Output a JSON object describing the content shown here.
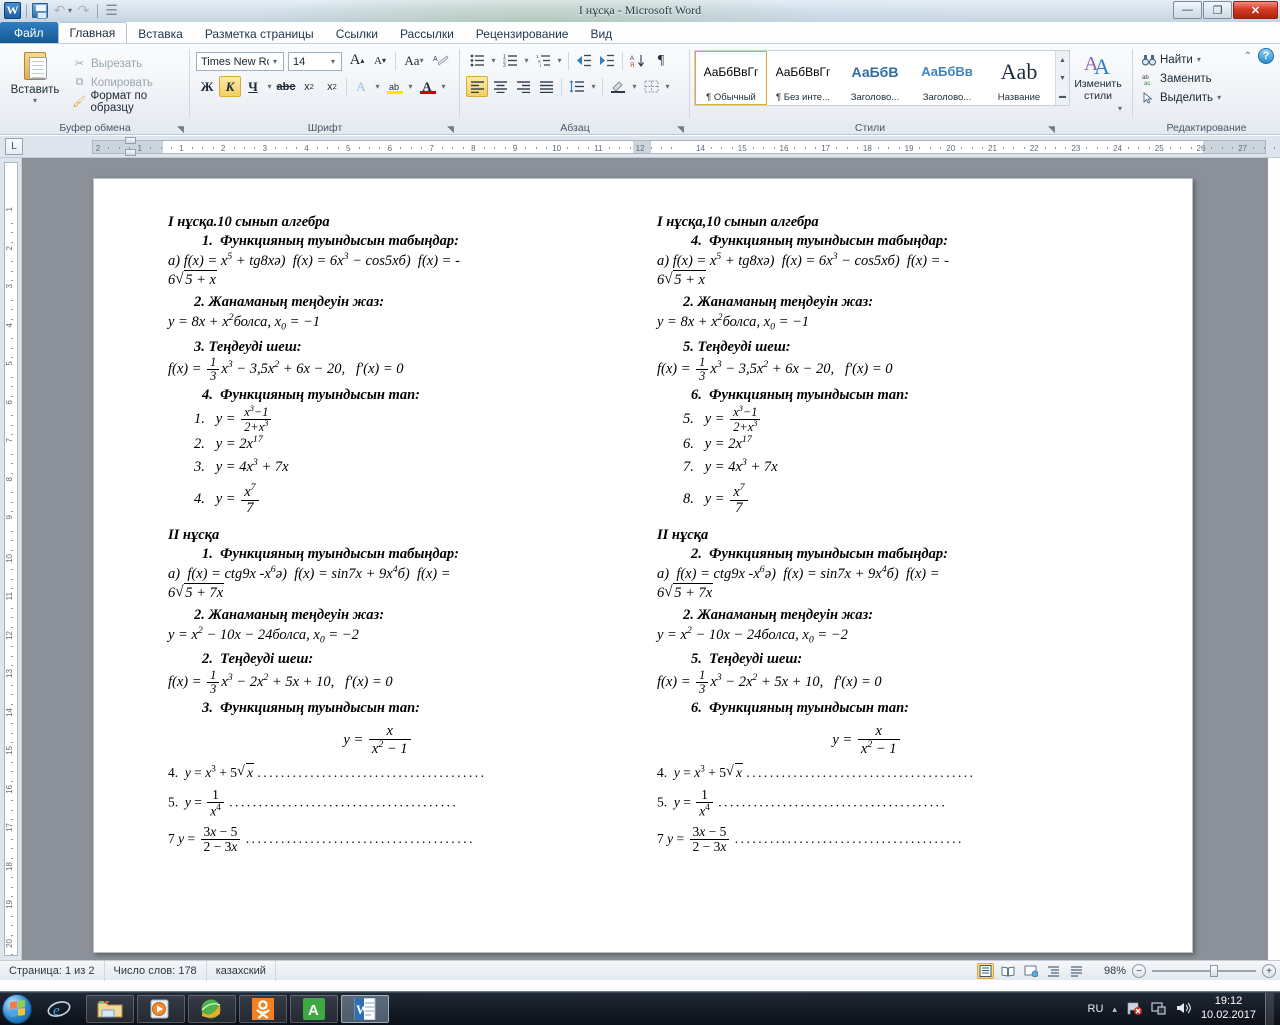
{
  "window": {
    "title": "I нұсқа  -  Microsoft Word",
    "minimize": "—",
    "maximize": "❐",
    "close": "✕",
    "help": "?",
    "collapse_ribbon": "⌃",
    "qat": {
      "word_icon": "W",
      "save": "save-icon",
      "undo": "↶",
      "redo": "↷",
      "customize": "▾"
    }
  },
  "tabs": [
    {
      "label": "Файл",
      "id": "file"
    },
    {
      "label": "Главная",
      "id": "home"
    },
    {
      "label": "Вставка",
      "id": "insert"
    },
    {
      "label": "Разметка страницы",
      "id": "layout"
    },
    {
      "label": "Ссылки",
      "id": "references"
    },
    {
      "label": "Рассылки",
      "id": "mailings"
    },
    {
      "label": "Рецензирование",
      "id": "review"
    },
    {
      "label": "Вид",
      "id": "view"
    }
  ],
  "ribbon": {
    "clipboard": {
      "group_label": "Буфер обмена",
      "paste": "Вставить",
      "paste_arrow": "▾",
      "cut": "Вырезать",
      "copy": "Копировать",
      "format_painter": "Формат по образцу"
    },
    "font": {
      "group_label": "Шрифт",
      "font_name": "Times New Rc",
      "font_size": "14",
      "grow": "A",
      "shrink": "A",
      "change_case": "Aa",
      "clear_format": "A",
      "bold": "Ж",
      "italic": "К",
      "underline": "Ч",
      "strike": "abc",
      "subscript": "x₂",
      "superscript": "x²",
      "text_effects": "A",
      "highlight": "ab",
      "font_color": "A",
      "arrow": "▾"
    },
    "paragraph": {
      "group_label": "Абзац",
      "bullets": "•≡",
      "numbering": "1≡",
      "multilevel": "¹≡",
      "decrease_indent": "⇤",
      "increase_indent": "⇥",
      "sort": "А Я",
      "show_marks": "¶",
      "align_left": "≡",
      "align_center": "≡",
      "align_right": "≡",
      "justify": "≡",
      "line_spacing": "↕≡",
      "shading": "▩",
      "borders": "▦"
    },
    "styles": {
      "group_label": "Стили",
      "change_styles": "Изменить\nстили",
      "change_styles_line1": "Изменить",
      "change_styles_line2": "стили",
      "items": [
        {
          "preview": "АаБбВвГг",
          "name": "¶ Обычный",
          "selected": true
        },
        {
          "preview": "АаБбВвГг",
          "name": "¶ Без инте...",
          "selected": false
        },
        {
          "preview": "АаБбВ",
          "name": "Заголово...",
          "selected": false
        },
        {
          "preview": "АаБбВв",
          "name": "Заголово...",
          "selected": false
        },
        {
          "preview": "Aab",
          "name": "Название",
          "selected": false
        }
      ]
    },
    "editing": {
      "group_label": "Редактирование",
      "find": "Найти",
      "replace": "Заменить",
      "select": "Выделить",
      "arrow": "▾"
    }
  },
  "ruler": {
    "horizontal_left": [
      "2",
      "1",
      "1",
      "2",
      "3",
      "4",
      "5",
      "6",
      "7",
      "8",
      "9",
      "10",
      "11",
      "12"
    ],
    "horizontal_right": [
      "14",
      "15",
      "16",
      "17",
      "18",
      "19",
      "20",
      "21",
      "22",
      "23",
      "24",
      "25",
      "26",
      "27"
    ],
    "vertical": [
      "1",
      "2",
      "3",
      "4",
      "5",
      "6",
      "7",
      "8",
      "9",
      "10",
      "11",
      "12",
      "13",
      "14",
      "15",
      "16",
      "17",
      "18",
      "19",
      "20"
    ]
  },
  "document": {
    "columns": [
      {
        "id": "left-column",
        "lines": [
          {
            "t": "heading",
            "text": "I нұсқа.10 сынып алгебра"
          },
          {
            "t": "task",
            "num": "1.",
            "text": "Функцияның туындысын табыңдар:"
          },
          {
            "t": "formula",
            "text": "а) f(x) = x⁵ + tg8xә)  f(x) = 6x³ − cos5xб)  f(x) = - 6√5 + x"
          },
          {
            "t": "task2",
            "num": "2.",
            "text": "Жанаманың теңдеуін жаз:"
          },
          {
            "t": "formula",
            "text": "y = 8x + x²болса, x₀ =  −1"
          },
          {
            "t": "task2",
            "num": "3.",
            "text": "Теңдеуді шеш:"
          },
          {
            "t": "formula",
            "text": "f(x) = ⅓x³ − 3,5x² + 6x − 20,   f′(x) = 0"
          },
          {
            "t": "task",
            "num": "4.",
            "text": "Функцияның туындысын тап:"
          },
          {
            "t": "item",
            "num": "1.",
            "text": "y = (x³−1)/(2+x³)"
          },
          {
            "t": "item",
            "num": "2.",
            "text": "y = 2x¹⁷"
          },
          {
            "t": "item",
            "num": "3.",
            "text": "y = 4x³ + 7x"
          },
          {
            "t": "item",
            "num": "4.",
            "text": "y = x⁷/7"
          },
          {
            "t": "heading",
            "text": "II нұсқа"
          },
          {
            "t": "task",
            "num": "1.",
            "text": "Функцияның туындысын табыңдар:"
          },
          {
            "t": "formula",
            "text": "а)  f(x) = ctg9x -x⁶ә)  f(x) = sin7x + 9x⁴б)  f(x) = 6√5 + 7x"
          },
          {
            "t": "task2",
            "num": "2.",
            "text": "Жанаманың теңдеуін жаз:"
          },
          {
            "t": "formula",
            "text": "y = x² − 10x − 24болса, x₀ =  −2"
          },
          {
            "t": "task2",
            "num": "2.",
            "text": "Теңдеуді шеш:"
          },
          {
            "t": "formula",
            "text": "f(x) = ⅓x³ − 2x² + 5x + 10,   f′(x) = 0"
          },
          {
            "t": "task",
            "num": "3.",
            "text": "Функцияның туындысын тап:"
          },
          {
            "t": "centered",
            "text": "y = x/(x² − 1)"
          },
          {
            "t": "dotted",
            "num": "4.",
            "text": "y = x³ + 5√x"
          },
          {
            "t": "dotted",
            "num": "5.",
            "text": "y = 1/x⁴"
          },
          {
            "t": "dotted",
            "num": "7",
            "text": "y = (3x−5)/(2−3x)"
          }
        ],
        "headings": {
          "h1": "I нұсқа.10 сынып алгебра",
          "h2": "II нұсқа"
        },
        "numbers": {
          "t1": "1.",
          "t2": "2.",
          "t3": "3.",
          "t4": "4.",
          "s1": "1.",
          "s2": "2.",
          "s3": "3.",
          "s4": "4.",
          "u1": "1.",
          "u2": "2.",
          "u3": "2.",
          "u4": "3.",
          "b4": "4.",
          "b5": "5.",
          "b7": "7"
        }
      },
      {
        "id": "right-column",
        "headings": {
          "h1": "I нұсқа,10 сынып алгебра",
          "h2": "II нұсқа"
        },
        "numbers": {
          "t1": "4.",
          "t2": "2.",
          "t3": "5.",
          "t4": "6.",
          "s1": "5.",
          "s2": "6.",
          "s3": "7.",
          "s4": "8.",
          "u1": "2.",
          "u2": "2.",
          "u3": "5.",
          "u4": "6.",
          "b4": "4.",
          "b5": "5.",
          "b7": "7"
        }
      }
    ],
    "text": {
      "find_derivative": "Функцияның туындысын табыңдар:",
      "tangent_equation": "Жанаманың теңдеуін жаз:",
      "solve_equation": "Теңдеуді шеш:",
      "find_derivative_short": "Функцияның туындысын тап:",
      "bolsa": "болса",
      "dots": "......................................."
    }
  },
  "status": {
    "page": "Страница: 1 из 2",
    "words": "Число слов: 178",
    "language": "казахский",
    "zoom": "98%",
    "view_buttons": [
      "print-layout",
      "full-screen-reading",
      "web-layout",
      "outline",
      "draft"
    ],
    "zoom_out": "−",
    "zoom_in": "+"
  },
  "taskbar": {
    "start": "start-orb",
    "items": [
      {
        "name": "internet-explorer",
        "glyph": "e"
      },
      {
        "name": "windows-explorer",
        "glyph": ""
      },
      {
        "name": "media-player",
        "glyph": "▶"
      },
      {
        "name": "browser-app",
        "glyph": ""
      },
      {
        "name": "odnoklassniki",
        "glyph": "ok"
      },
      {
        "name": "abbyy-app",
        "glyph": "A"
      },
      {
        "name": "microsoft-word",
        "glyph": "W"
      }
    ],
    "tray": {
      "language": "RU",
      "time": "19:12",
      "date": "10.02.2017",
      "up_arrow": "▴"
    }
  },
  "colors": {
    "accent": "#1c5fa8",
    "highlight": "#f6cf62",
    "close_red": "#d33b22",
    "page_bg": "#ffffff"
  }
}
